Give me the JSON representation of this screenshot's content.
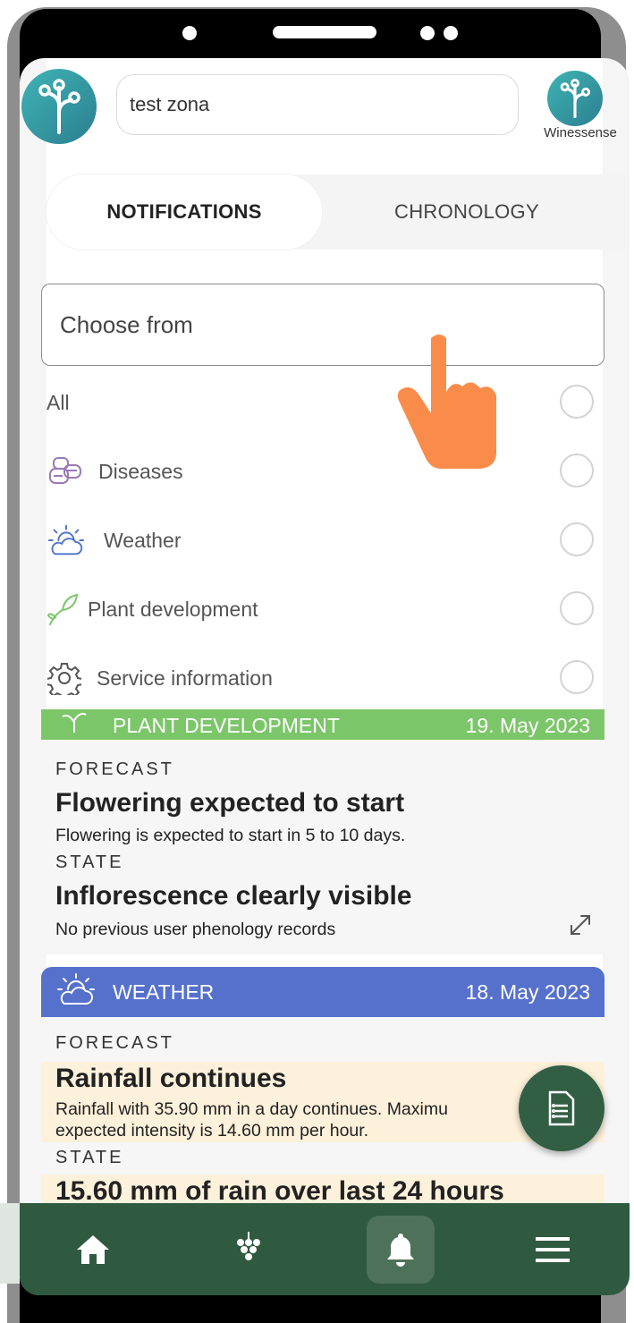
{
  "header": {
    "zone_value": "test zona",
    "brand_label": "Winessense"
  },
  "tabs": [
    {
      "label": "NOTIFICATIONS",
      "active": true
    },
    {
      "label": "CHRONOLOGY",
      "active": false
    }
  ],
  "filter": {
    "placeholder": "Choose from",
    "options": [
      {
        "label": "All",
        "icon": "none"
      },
      {
        "label": "Diseases",
        "icon": "diseases-icon"
      },
      {
        "label": "Weather",
        "icon": "weather-icon"
      },
      {
        "label": "Plant development",
        "icon": "plant-icon"
      },
      {
        "label": "Service information",
        "icon": "gear-icon"
      }
    ]
  },
  "cards": [
    {
      "category": "PLANT DEVELOPMENT",
      "date": "19. May 2023",
      "color": "#7cc66a",
      "forecast_label": "FORECAST",
      "forecast_title": "Flowering expected to start",
      "forecast_text": "Flowering is expected to start in 5 to 10 days.",
      "state_label": "STATE",
      "state_title": "Inflorescence clearly visible",
      "state_text": "No previous user phenology records"
    },
    {
      "category": "WEATHER",
      "date": "18. May 2023",
      "color": "#5671cc",
      "forecast_label": "FORECAST",
      "forecast_title": "Rainfall continues",
      "forecast_text_line1": "Rainfall with 35.90 mm in a day continues. Maximu",
      "forecast_text_line2": "expected intensity is 14.60 mm per hour.",
      "state_label": "STATE",
      "state_title": "15.60 mm of rain over last 24 hours"
    }
  ],
  "bottom_nav": [
    {
      "icon": "home-icon",
      "active": false
    },
    {
      "icon": "grapes-icon",
      "active": false
    },
    {
      "icon": "bell-icon",
      "active": true
    },
    {
      "icon": "menu-icon",
      "active": false
    }
  ],
  "colors": {
    "nav_bg": "#2f5a3f",
    "plant_header": "#7cc66a",
    "weather_header": "#5671cc",
    "pointer_hand": "#f98c4a",
    "logo": "#3fb3b5"
  }
}
